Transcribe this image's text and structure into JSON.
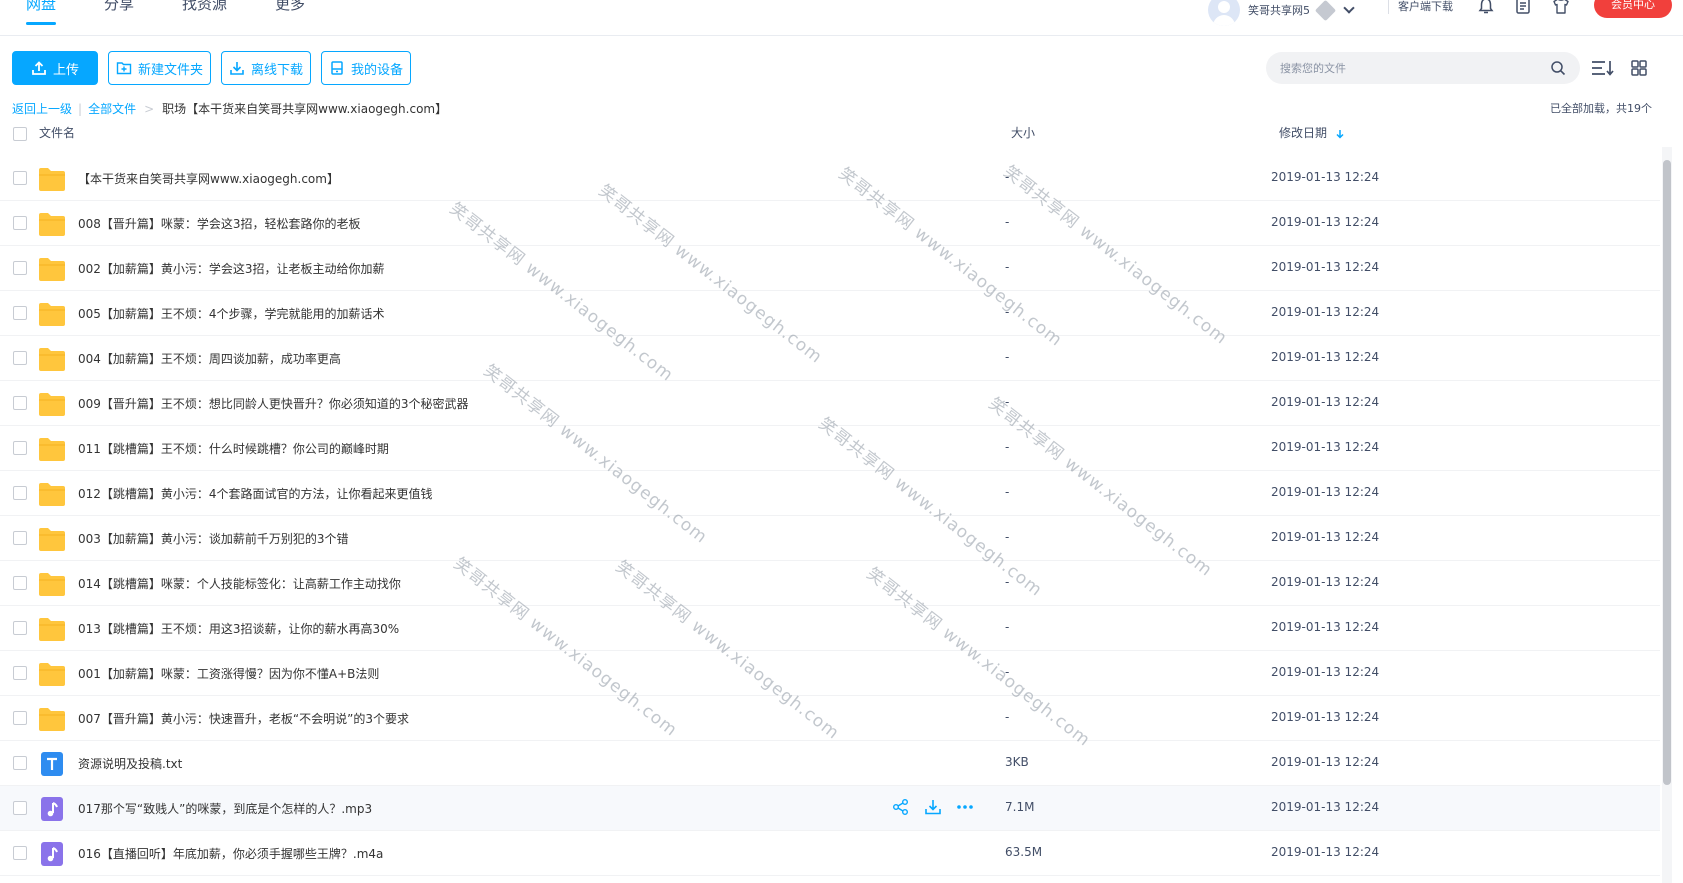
{
  "nav": {
    "tabs": [
      {
        "label": "网盘",
        "active": true
      },
      {
        "label": "分享",
        "active": false
      },
      {
        "label": "找资源",
        "active": false
      },
      {
        "label": "更多",
        "active": false
      }
    ]
  },
  "user": {
    "name": "笑哥共享网5",
    "client_download": "客户端下载",
    "vip_center": "会员中心"
  },
  "toolbar": {
    "upload": "上传",
    "new_folder": "新建文件夹",
    "offline_download": "离线下载",
    "my_devices": "我的设备"
  },
  "search": {
    "placeholder": "搜索您的文件"
  },
  "breadcrumb": {
    "back": "返回上一级",
    "separator": "|",
    "all_files": "全部文件",
    "arrow": ">",
    "current": "职场【本干货来自笑哥共享网www.xiaogegh.com】"
  },
  "status": {
    "loaded_text": "已全部加载，共19个"
  },
  "columns": {
    "name": "文件名",
    "size": "大小",
    "date": "修改日期"
  },
  "files": [
    {
      "type": "folder",
      "name": "【本干货来自笑哥共享网www.xiaogegh.com】",
      "size": "-",
      "date": "2019-01-13 12:24"
    },
    {
      "type": "folder",
      "name": "008【晋升篇】咪蒙：学会这3招，轻松套路你的老板",
      "size": "-",
      "date": "2019-01-13 12:24"
    },
    {
      "type": "folder",
      "name": "002【加薪篇】黄小污：学会这3招，让老板主动给你加薪",
      "size": "-",
      "date": "2019-01-13 12:24"
    },
    {
      "type": "folder",
      "name": "005【加薪篇】王不烦：4个步骤，学完就能用的加薪话术",
      "size": "-",
      "date": "2019-01-13 12:24"
    },
    {
      "type": "folder",
      "name": "004【加薪篇】王不烦：周四谈加薪，成功率更高",
      "size": "-",
      "date": "2019-01-13 12:24"
    },
    {
      "type": "folder",
      "name": "009【晋升篇】王不烦：想比同龄人更快晋升？你必须知道的3个秘密武器",
      "size": "-",
      "date": "2019-01-13 12:24"
    },
    {
      "type": "folder",
      "name": "011【跳槽篇】王不烦：什么时候跳槽？你公司的巅峰时期",
      "size": "-",
      "date": "2019-01-13 12:24"
    },
    {
      "type": "folder",
      "name": "012【跳槽篇】黄小污：4个套路面试官的方法，让你看起来更值钱",
      "size": "-",
      "date": "2019-01-13 12:24"
    },
    {
      "type": "folder",
      "name": "003【加薪篇】黄小污：谈加薪前千万别犯的3个错",
      "size": "-",
      "date": "2019-01-13 12:24"
    },
    {
      "type": "folder",
      "name": "014【跳槽篇】咪蒙：个人技能标签化：让高薪工作主动找你",
      "size": "-",
      "date": "2019-01-13 12:24"
    },
    {
      "type": "folder",
      "name": "013【跳槽篇】王不烦：用这3招谈薪，让你的薪水再高30%",
      "size": "-",
      "date": "2019-01-13 12:24"
    },
    {
      "type": "folder",
      "name": "001【加薪篇】咪蒙：工资涨得慢？因为你不懂A+B法则",
      "size": "-",
      "date": "2019-01-13 12:24"
    },
    {
      "type": "folder",
      "name": "007【晋升篇】黄小污：快速晋升，老板“不会明说”的3个要求",
      "size": "-",
      "date": "2019-01-13 12:24"
    },
    {
      "type": "txt",
      "name": "资源说明及投稿.txt",
      "size": "3KB",
      "date": "2019-01-13 12:24"
    },
    {
      "type": "audio",
      "name": "017那个写“致贱人”的咪蒙，到底是个怎样的人？.mp3",
      "size": "7.1M",
      "date": "2019-01-13 12:24",
      "hover": true
    },
    {
      "type": "audio",
      "name": "016【直播回听】年底加薪，你必须手握哪些王牌？.m4a",
      "size": "63.5M",
      "date": "2019-01-13 12:24"
    }
  ],
  "watermark": {
    "text": "笑哥共享网 www.xiaogegh.com"
  },
  "colors": {
    "accent": "#06a7ff",
    "vip": "#f1403c",
    "folder": "#ffc63d",
    "txt": "#2e8cf0",
    "audio": "#8a73ea"
  }
}
